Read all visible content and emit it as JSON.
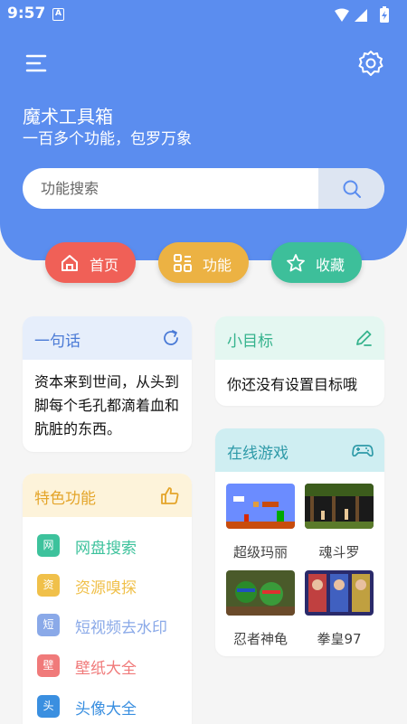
{
  "status_bar": {
    "time": "9:57",
    "notification_icon": "A"
  },
  "header": {
    "title": "魔术工具箱",
    "subtitle": "一百多个功能，包罗万象",
    "accent_color": "#5b8def"
  },
  "search": {
    "placeholder": "功能搜索",
    "value": ""
  },
  "nav": {
    "home": "首页",
    "functions": "功能",
    "favorites": "收藏"
  },
  "quote_card": {
    "title": "一句话",
    "text": "资本来到世间，从头到脚每个毛孔都滴着血和肮脏的东西。"
  },
  "goal_card": {
    "title": "小目标",
    "text": "你还没有设置目标哦"
  },
  "features_card": {
    "title": "特色功能",
    "items": [
      {
        "badge": "网",
        "label": "网盘搜索",
        "color": "#3dc29c"
      },
      {
        "badge": "资",
        "label": "资源嗅探",
        "color": "#f0c04a"
      },
      {
        "badge": "短",
        "label": "短视频去水印",
        "color": "#8aa9e8"
      },
      {
        "badge": "壁",
        "label": "壁纸大全",
        "color": "#f07a7a"
      },
      {
        "badge": "头",
        "label": "头像大全",
        "color": "#3a8fe0"
      }
    ]
  },
  "games_card": {
    "title": "在线游戏",
    "games": [
      {
        "name": "超级玛丽"
      },
      {
        "name": "魂斗罗"
      },
      {
        "name": "忍者神龟"
      },
      {
        "name": "拳皇97"
      }
    ]
  }
}
